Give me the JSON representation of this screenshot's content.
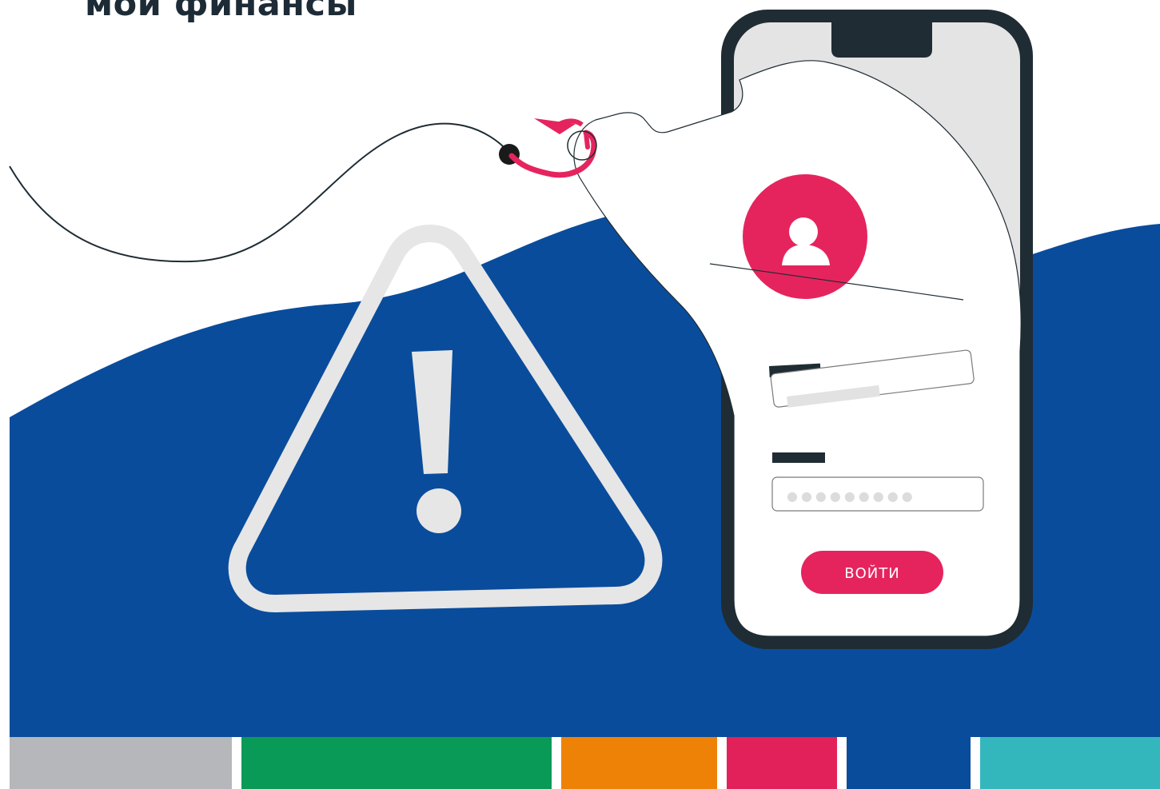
{
  "header": {
    "brand_title": "мои финансы"
  },
  "phone_login": {
    "password_mask": "●●●●●●●●●",
    "login_button_label": "ВОЙТИ"
  },
  "icons": {
    "warning": "warning-triangle-icon",
    "user": "user-avatar-icon",
    "hook": "fishing-hook-icon"
  },
  "colors": {
    "navy_wave": "#0a4c9c",
    "accent_pink": "#e5245e",
    "phone_frame": "#1f2c33",
    "warning_outline": "#e6e6e6",
    "stripe": [
      "#b5b7ba",
      "#0a9a58",
      "#ee8207",
      "#e2215b",
      "#0a4c9c",
      "#33b7bd"
    ]
  }
}
